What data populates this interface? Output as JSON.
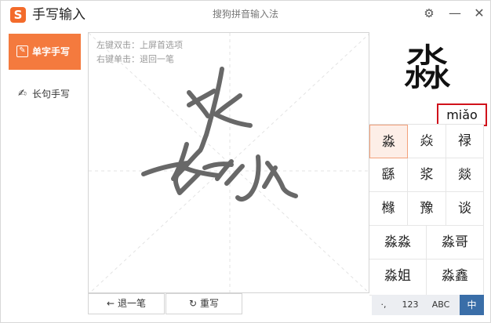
{
  "app": {
    "logo_letter": "S",
    "title": "手写输入",
    "window_title": "搜狗拼音输入法"
  },
  "titlebar": {
    "settings_icon": "gear-icon",
    "minimize_icon": "minimize-icon",
    "close_icon": "close-icon"
  },
  "sidebar": {
    "items": [
      {
        "label": "单字手写",
        "icon": "single-char-handwriting-icon",
        "active": true
      },
      {
        "label": "长句手写",
        "icon": "long-sentence-handwriting-icon",
        "active": false
      }
    ]
  },
  "pad": {
    "hint_double_left": "左键双击：上屏首选项",
    "hint_right_click": "右键单击：退回一笔",
    "undo_label": "退一笔",
    "rewrite_label": "重写"
  },
  "preview": {
    "char": "淼",
    "pinyin": "miǎo"
  },
  "candidates": [
    {
      "text": "淼",
      "selected": true
    },
    {
      "text": "焱"
    },
    {
      "text": "禄"
    },
    {
      "text": "繇"
    },
    {
      "text": "浆"
    },
    {
      "text": "燚"
    },
    {
      "text": "橼"
    },
    {
      "text": "豫"
    },
    {
      "text": "谈"
    },
    {
      "text": "淼淼"
    },
    {
      "text": "淼哥"
    },
    {
      "text": "淼姐"
    },
    {
      "text": "淼鑫"
    }
  ],
  "bottom_bar": {
    "punct": "·,",
    "num": "123",
    "abc": "ABC",
    "zh": "中"
  },
  "colors": {
    "accent": "#f47a3e",
    "pinyin_border": "#d0121b",
    "ink": "#666666",
    "zh_active": "#3a6ea8"
  }
}
